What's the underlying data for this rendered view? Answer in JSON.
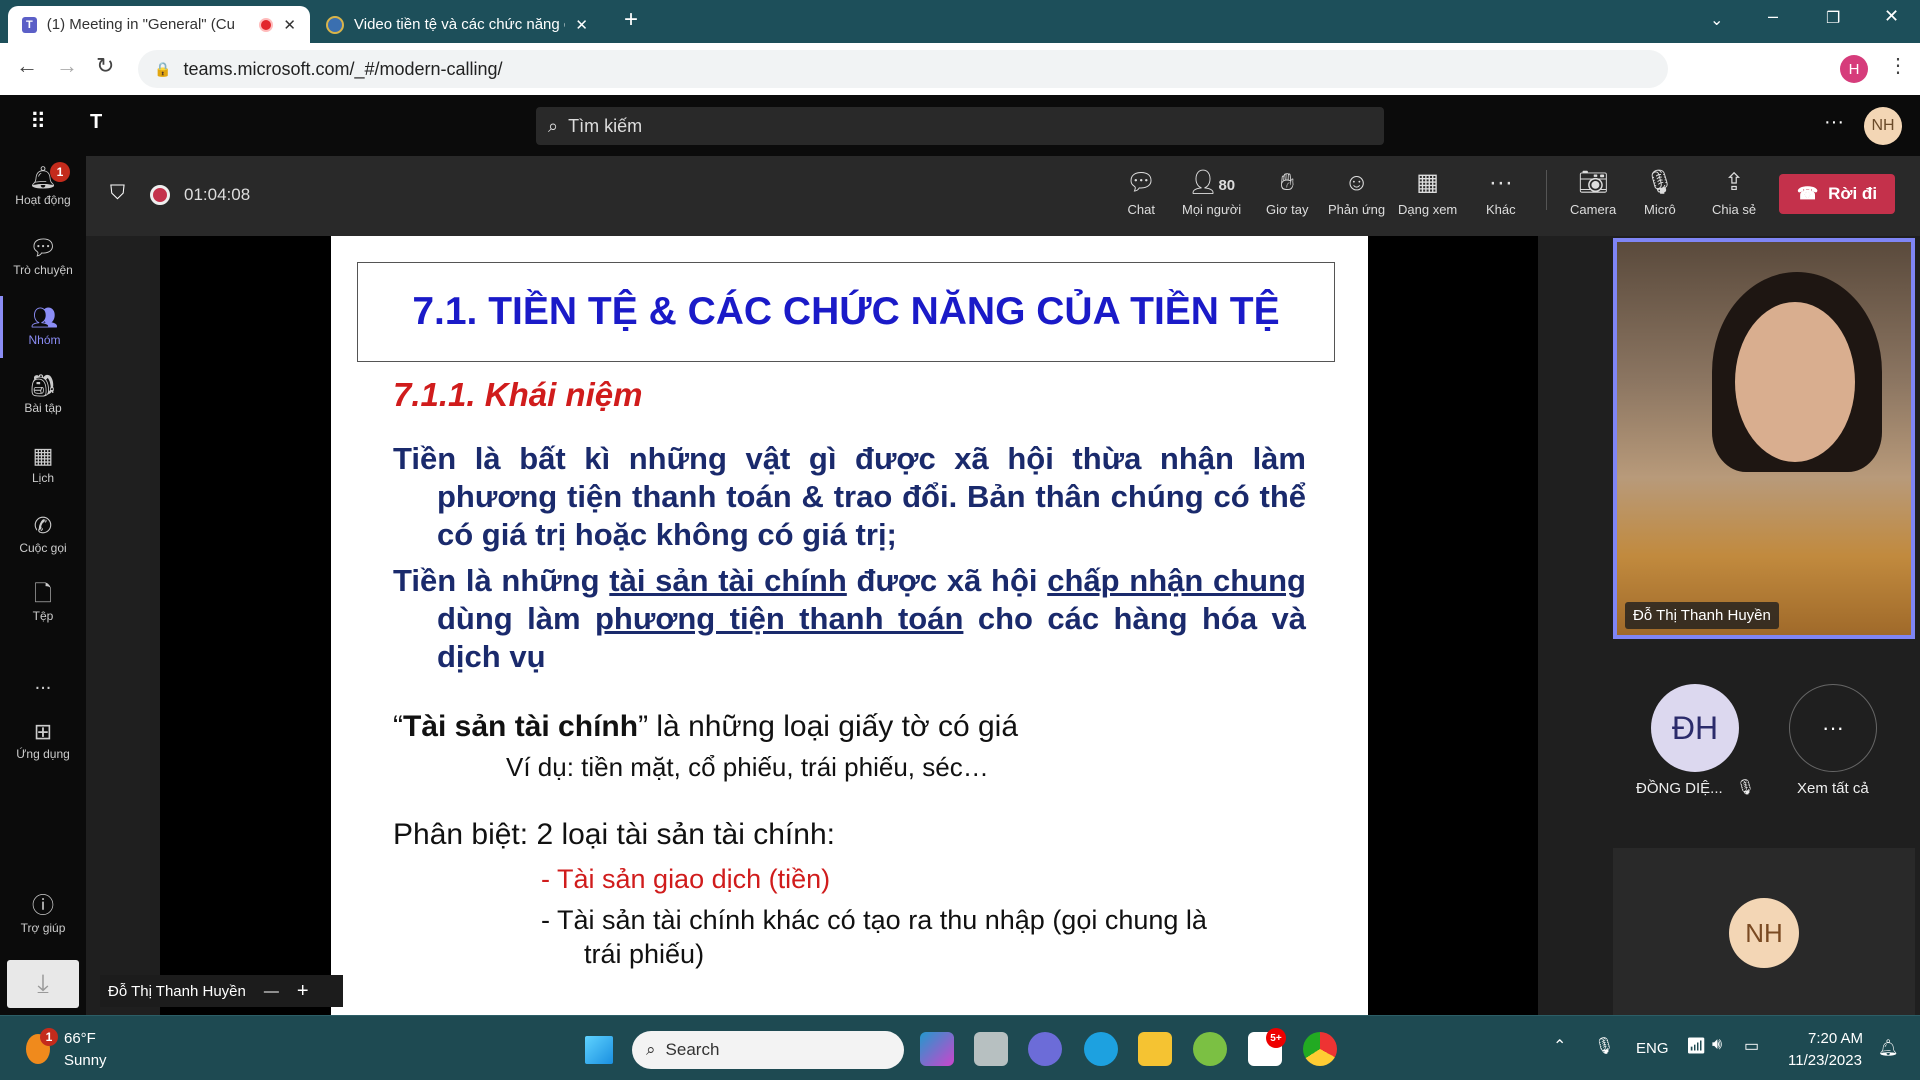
{
  "browser": {
    "tabs": [
      {
        "title": "(1) Meeting in \"General\" (Cu"
      },
      {
        "title": "Video tiền tệ và các chức năng c"
      }
    ],
    "url": "teams.microsoft.com/_#/modern-calling/",
    "profile": "H"
  },
  "teams": {
    "search_placeholder": "Tìm kiếm",
    "user_initials": "NH",
    "rail": [
      {
        "label": "Hoạt động",
        "badge": "1"
      },
      {
        "label": "Trò chuyện"
      },
      {
        "label": "Nhóm"
      },
      {
        "label": "Bài tập"
      },
      {
        "label": "Lịch"
      },
      {
        "label": "Cuộc gọi"
      },
      {
        "label": "Tệp"
      },
      {
        "label": "..."
      },
      {
        "label": "Ứng dụng"
      },
      {
        "label": "Trợ giúp"
      }
    ]
  },
  "meeting": {
    "timer": "01:04:08",
    "participants_count": "80",
    "toolbar": {
      "chat": "Chat",
      "people": "Mọi người",
      "raise_hand": "Giơ tay",
      "react": "Phản ứng",
      "view": "Dạng xem",
      "more": "Khác",
      "camera": "Camera",
      "mic": "Micrô",
      "share": "Chia sẻ",
      "leave": "Rời đi"
    },
    "presenter": "Đỗ Thị Thanh Huyền",
    "participants": [
      {
        "initials": "ĐH",
        "name": "ĐỒNG DIỆ..."
      },
      {
        "label": "Xem tất cả"
      },
      {
        "initials": "NH"
      }
    ]
  },
  "slide": {
    "title": "7.1. TIỀN TỆ & CÁC CHỨC NĂNG CỦA TIỀN TỆ",
    "subtitle": "7.1.1. Khái niệm",
    "p1": "Tiền là bất kì những vật gì được xã hội thừa nhận làm phương tiện thanh toán & trao đổi. Bản thân chúng có thể có giá trị hoặc không có giá trị;",
    "p2": {
      "a": "Tiền là những ",
      "b": "tài sản tài chính",
      "c": " được xã hội ",
      "d": "chấp nhận chung",
      "e": " dùng làm ",
      "f": "phương tiện thanh toán",
      "g": " cho các hàng hóa và dịch vụ"
    },
    "def_q1": "“",
    "def_bold": "Tài sản tài chính",
    "def_rest": "” là những loại giấy tờ có giá",
    "example": "Ví dụ: tiền mặt, cổ phiếu, trái phiếu, séc…",
    "distinguish": "Phân biệt: 2 loại tài sản tài chính:",
    "item1": "- Tài sản giao dịch (tiền)",
    "item2a": "- Tài sản tài chính khác có tạo ra thu nhập (gọi chung là",
    "item2b": "trái phiếu)"
  },
  "taskbar": {
    "temp": "66°F",
    "weather": "Sunny",
    "weather_badge": "1",
    "search": "Search",
    "zalo_badge": "5+",
    "lang": "ENG",
    "time": "7:20 AM",
    "date": "11/23/2023"
  }
}
